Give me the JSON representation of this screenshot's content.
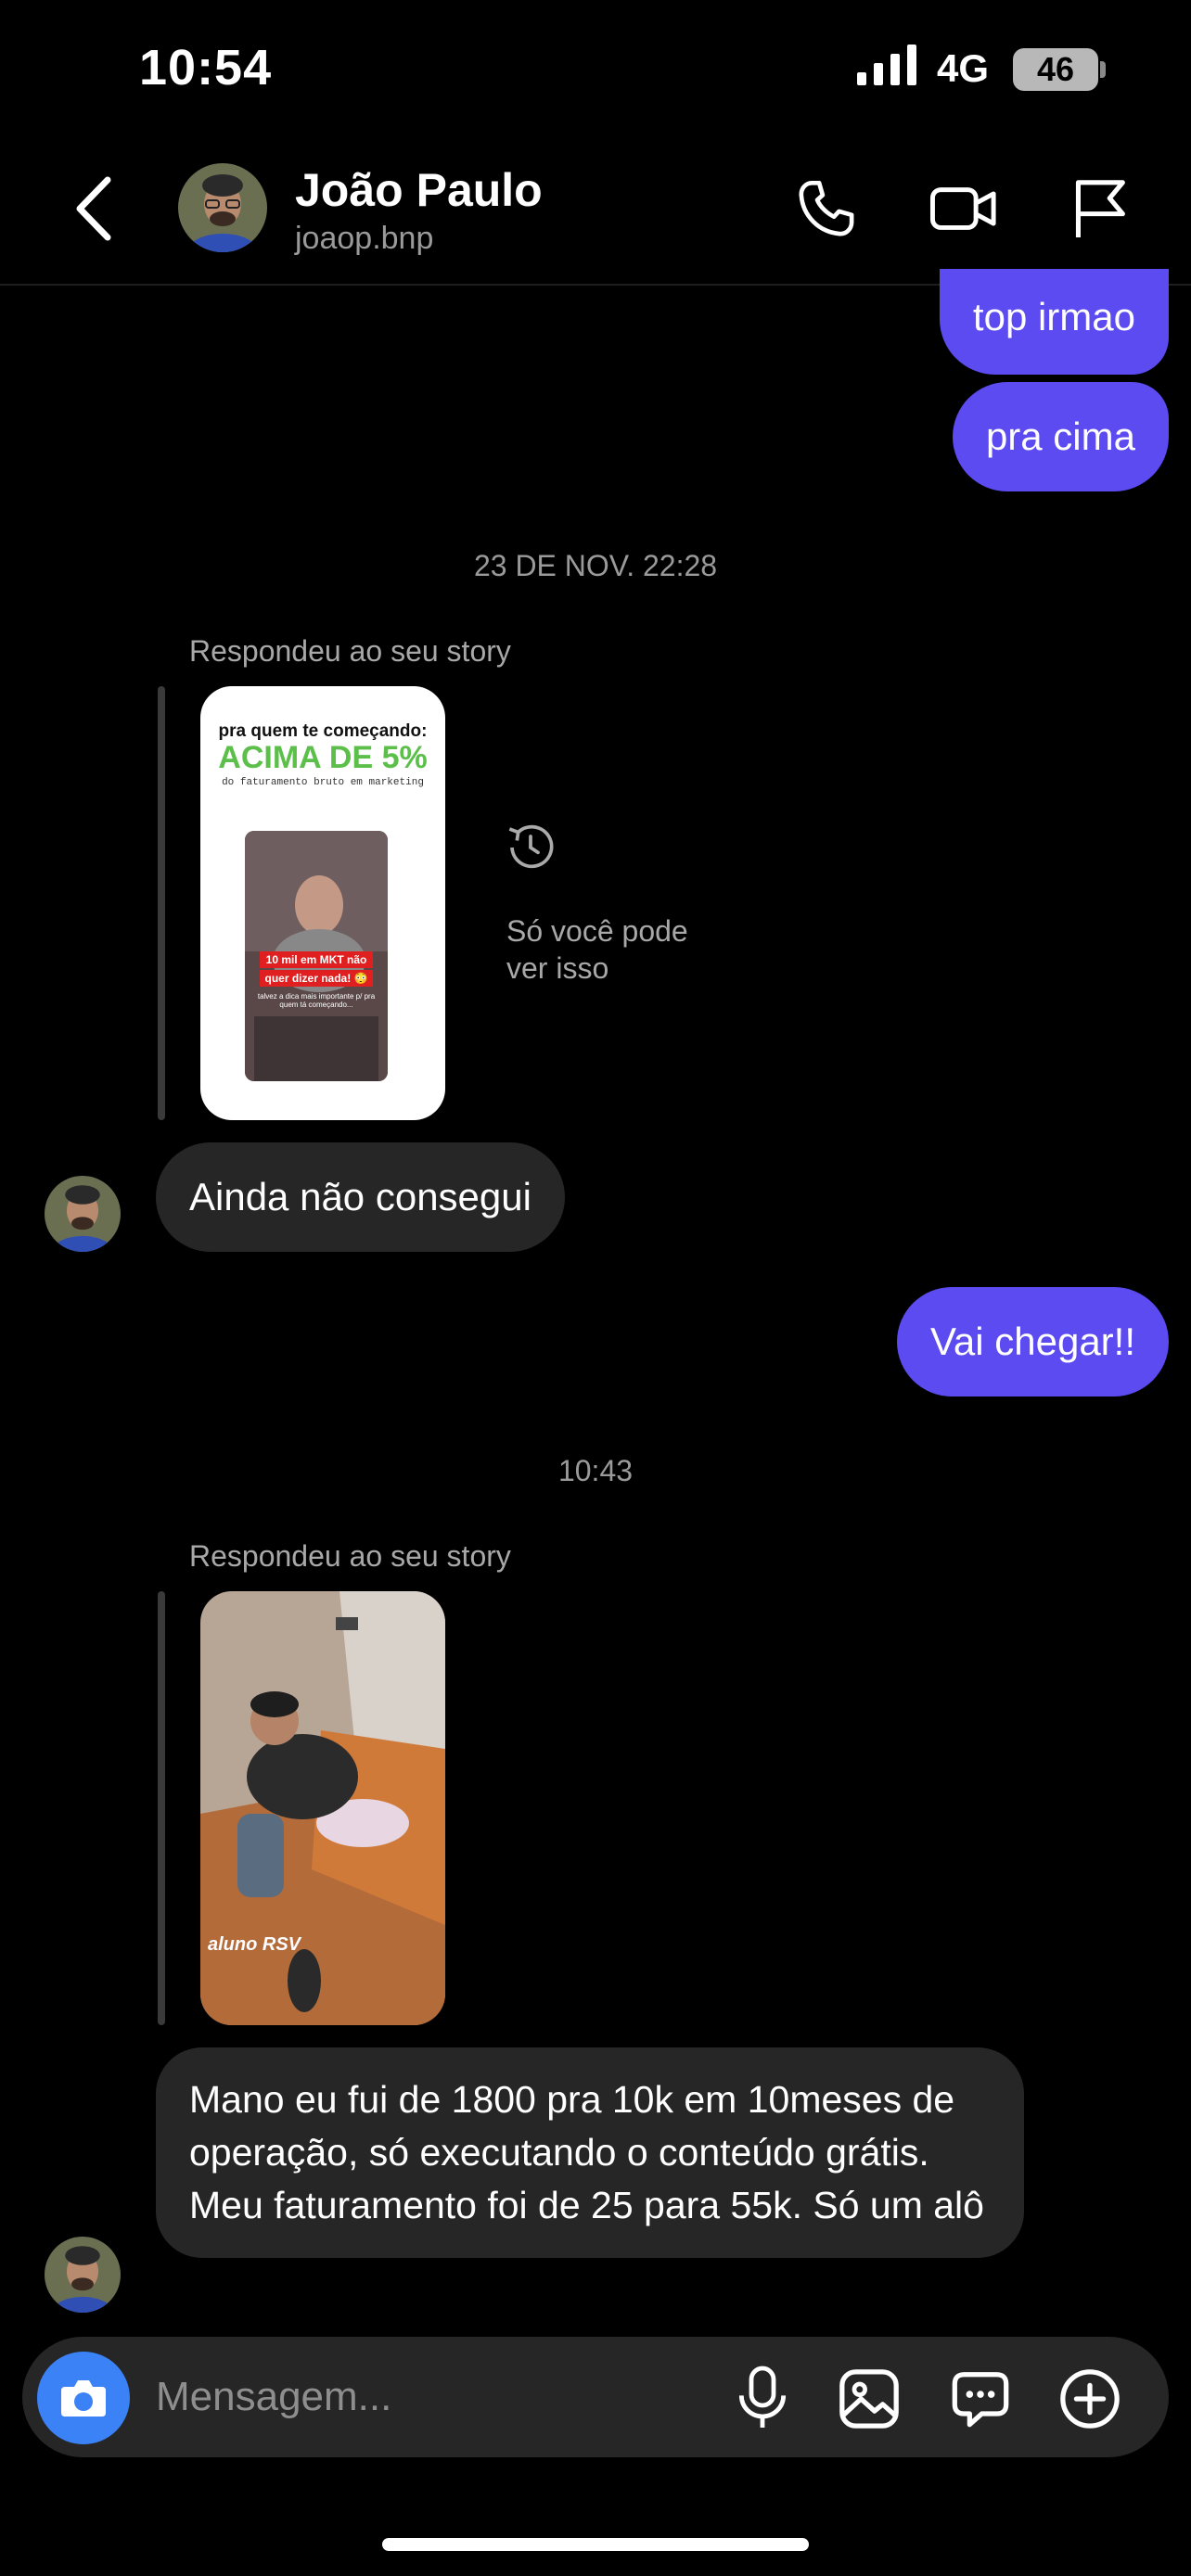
{
  "status_bar": {
    "time": "10:54",
    "network": "4G",
    "battery": "46"
  },
  "header": {
    "name": "João Paulo",
    "username": "joaop.bnp"
  },
  "messages": {
    "sent_top_1": "top irmao",
    "sent_top_2": "pra cima",
    "date_1": "23 DE NOV. 22:28",
    "reply_label_1": "Respondeu ao seu story",
    "story_1": {
      "headline_small": "pra quem te começando:",
      "headline_big": "ACIMA DE 5%",
      "headline_sub": "do faturamento bruto em marketing",
      "overlay_line1": "10 mil em MKT não",
      "overlay_line2": "quer dizer nada! 😳",
      "overlay_caption": "talvez a dica mais importante p/ pra quem tá começando..."
    },
    "expired_note": "Só você pode ver isso",
    "recv_1": "Ainda não consegui",
    "sent_1": "Vai chegar!!",
    "date_2": "10:43",
    "reply_label_2": "Respondeu ao seu story",
    "story_2": {
      "caption": "aluno RSV"
    },
    "recv_2": "Mano eu fui de 1800 pra 10k em 10meses de operação, só executando o conteúdo grátis. Meu faturamento foi de 25 para 55k. Só um alô"
  },
  "composer": {
    "placeholder": "Mensagem..."
  },
  "colors": {
    "sent_bubble": "#5b4bf0",
    "recv_bubble": "#262626",
    "camera_button": "#3b82f6",
    "story_green": "#5bbf4a"
  }
}
